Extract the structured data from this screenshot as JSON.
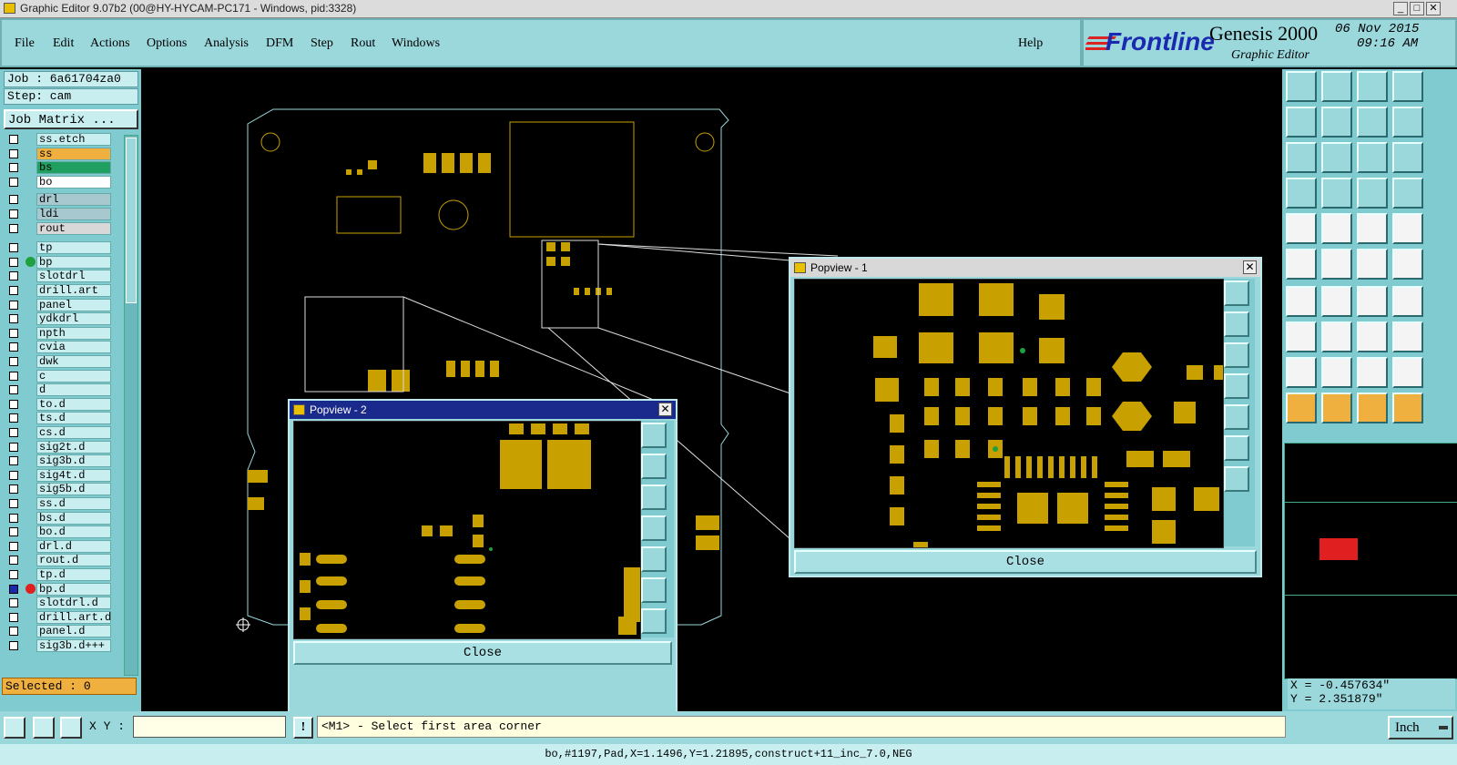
{
  "window": {
    "title": "Graphic Editor 9.07b2 (00@HY-HYCAM-PC171 - Windows, pid:3328)"
  },
  "menu": {
    "items": [
      "File",
      "Edit",
      "Actions",
      "Options",
      "Analysis",
      "DFM",
      "Step",
      "Rout",
      "Windows"
    ],
    "help": "Help"
  },
  "brand": {
    "logo": "Frontline",
    "product": "Genesis 2000",
    "subtitle": "Graphic Editor",
    "date": "06 Nov 2015",
    "time": "09:16 AM"
  },
  "job": {
    "label": "Job : 6a61704za0",
    "step": "Step: cam",
    "matrix_button": "Job Matrix ..."
  },
  "layers": [
    {
      "name": "ss.etch",
      "color": "#c8eef0"
    },
    {
      "name": "ss",
      "color": "#f0b040"
    },
    {
      "name": "bs",
      "color": "#20a060"
    },
    {
      "name": "bo",
      "color": "#ffffff"
    },
    {
      "name": "drl",
      "color": "#a8c8d0"
    },
    {
      "name": "ldi",
      "color": "#a8c8d0"
    },
    {
      "name": "rout",
      "color": "#d8d8d8"
    },
    {
      "name": "tp",
      "color": "#c8eef0"
    },
    {
      "name": "bp",
      "color": "#c8eef0"
    },
    {
      "name": "slotdrl",
      "color": "#c8eef0"
    },
    {
      "name": "drill.art",
      "color": "#c8eef0"
    },
    {
      "name": "panel",
      "color": "#c8eef0"
    },
    {
      "name": "ydkdrl",
      "color": "#c8eef0"
    },
    {
      "name": "npth",
      "color": "#c8eef0"
    },
    {
      "name": "cvia",
      "color": "#c8eef0"
    },
    {
      "name": "dwk",
      "color": "#c8eef0"
    },
    {
      "name": "c",
      "color": "#c8eef0"
    },
    {
      "name": "d",
      "color": "#c8eef0"
    },
    {
      "name": "to.d",
      "color": "#c8eef0"
    },
    {
      "name": "ts.d",
      "color": "#c8eef0"
    },
    {
      "name": "cs.d",
      "color": "#c8eef0"
    },
    {
      "name": "sig2t.d",
      "color": "#c8eef0"
    },
    {
      "name": "sig3b.d",
      "color": "#c8eef0"
    },
    {
      "name": "sig4t.d",
      "color": "#c8eef0"
    },
    {
      "name": "sig5b.d",
      "color": "#c8eef0"
    },
    {
      "name": "ss.d",
      "color": "#c8eef0"
    },
    {
      "name": "bs.d",
      "color": "#c8eef0"
    },
    {
      "name": "bo.d",
      "color": "#c8eef0"
    },
    {
      "name": "drl.d",
      "color": "#c8eef0"
    },
    {
      "name": "rout.d",
      "color": "#c8eef0"
    },
    {
      "name": "tp.d",
      "color": "#c8eef0"
    },
    {
      "name": "bp.d",
      "color": "#c8eef0"
    },
    {
      "name": "slotdrl.d",
      "color": "#c8eef0"
    },
    {
      "name": "drill.art.d",
      "color": "#c8eef0"
    },
    {
      "name": "panel.d",
      "color": "#c8eef0"
    },
    {
      "name": "sig3b.d+++",
      "color": "#c8eef0"
    }
  ],
  "selected": "Selected : 0",
  "popview1": {
    "title": "Popview - 1",
    "close": "Close",
    "close_x": "✕"
  },
  "popview2": {
    "title": "Popview - 2",
    "close": "Close",
    "close_x": "✕"
  },
  "coords": {
    "x": "X = -0.457634\"",
    "y": "Y =  2.351879\""
  },
  "units": {
    "value": "Inch"
  },
  "cmd": {
    "xy_label": "X Y :",
    "xy_value": "",
    "prompt": "<M1> - Select first area corner"
  },
  "status": "bo,#1197,Pad,X=1.1496,Y=1.21895,construct+11_inc_7.0,NEG",
  "colors": {
    "pad": "#c8a000",
    "panel": "#9ad8dc",
    "outline": "#9ad8dc",
    "rout": "#e05050"
  }
}
